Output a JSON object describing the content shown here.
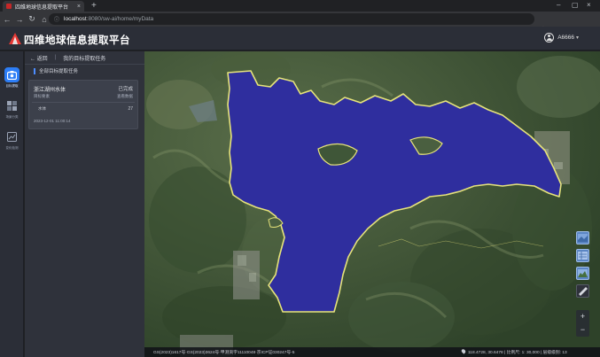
{
  "browser": {
    "tab_title": "四维地球信息提取平台",
    "tab_close": "×",
    "new_tab": "+",
    "url_host": "localhost",
    "url_path": ":8080/sw-ai/home/myData",
    "win_min": "–",
    "win_max": "▢",
    "win_close": "×"
  },
  "app": {
    "title": "四维地球信息提取平台",
    "user_name": "A6666",
    "user_chevron": "▾"
  },
  "rail": {
    "items": [
      {
        "label": "目标提取"
      },
      {
        "label": "场景分类"
      },
      {
        "label": "变化检测"
      }
    ]
  },
  "panel": {
    "back_label": "返回",
    "separator": "|",
    "breadcrumb": "我的目标提取任务",
    "filter_label": "全部目标提取任务",
    "task": {
      "name": "浙江湖州水体",
      "status": "已完成",
      "type": "目标要素",
      "action": "查看数据",
      "feature": "水体",
      "count": "27",
      "time": "2023-12-01 11:00:14"
    }
  },
  "status": {
    "copyright": "GS(2023)1617号·GS(2023)3624号·甲测资字11110048·京ICP证030247号-5",
    "coordinates": "118.4728, 30.6478 | 比例尺: 1: 30,000 | 层级级别: 13"
  },
  "map_controls": {
    "zoom_in": "+",
    "zoom_out": "−"
  },
  "colors": {
    "accent": "#2d7ef7",
    "water": "#2f2e9e",
    "boundary": "#e6e37a"
  }
}
